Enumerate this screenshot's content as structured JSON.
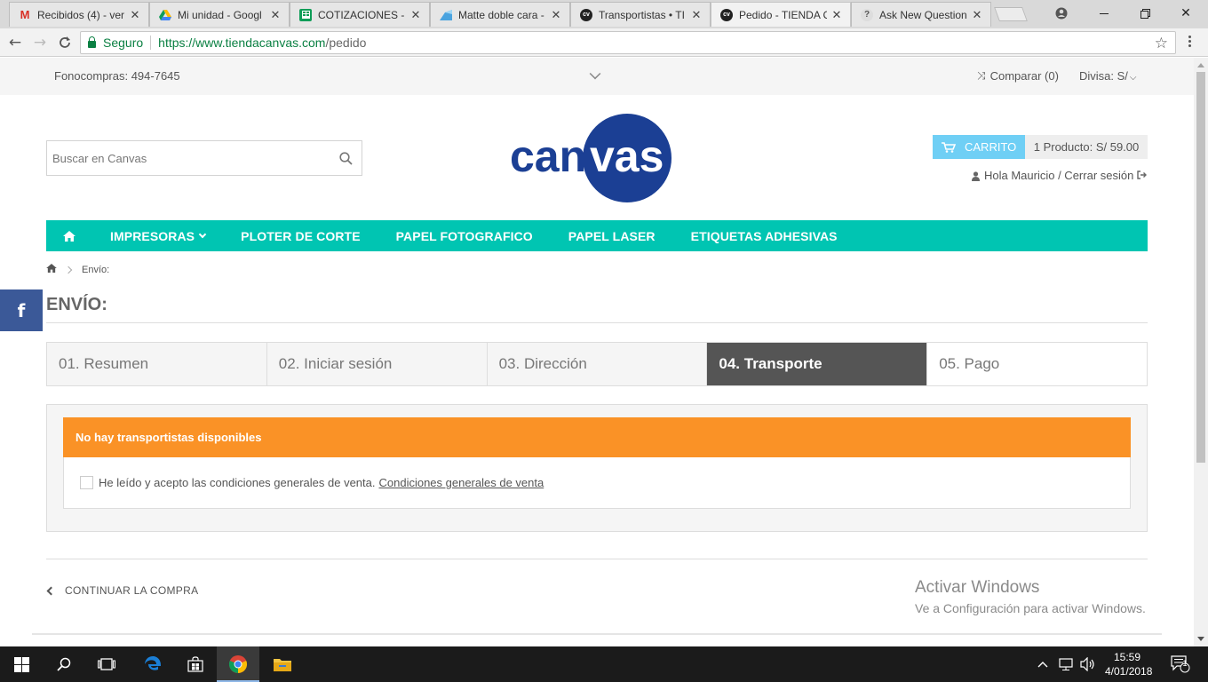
{
  "browser": {
    "tabs": [
      {
        "title": "Recibidos (4) - ver",
        "favicon": "gmail-icon"
      },
      {
        "title": "Mi unidad - Googl",
        "favicon": "drive-icon"
      },
      {
        "title": "COTIZACIONES - K",
        "favicon": "sheets-icon"
      },
      {
        "title": "Matte doble cara -",
        "favicon": "shop-icon"
      },
      {
        "title": "Transportistas • TI",
        "favicon": "canvas-icon"
      },
      {
        "title": "Pedido - TIENDA C",
        "favicon": "canvas-icon",
        "active": true
      },
      {
        "title": "Ask New Question",
        "favicon": "question-icon"
      }
    ],
    "secure_label": "Seguro",
    "url_host": "https://www.tiendacanvas.com",
    "url_path": "/pedido"
  },
  "site": {
    "phone": "Fonocompras: 494-7645",
    "compare": "Comparar (0)",
    "currency": "Divisa: S/",
    "search_placeholder": "Buscar en Canvas",
    "logo_text_left": "can",
    "logo_text_right": "vas",
    "cart_label": "CARRITO",
    "cart_info": "1 Producto: S/ 59.00",
    "greeting": "Hola Mauricio / Cerrar sesión",
    "nav": [
      "IMPRESORAS",
      "PLOTER DE CORTE",
      "PAPEL FOTOGRAFICO",
      "PAPEL LASER",
      "ETIQUETAS ADHESIVAS"
    ],
    "breadcrumb_current": "Envío:",
    "page_title": "ENVÍO:",
    "steps": [
      {
        "label": "01. Resumen"
      },
      {
        "label": "02. Iniciar sesión"
      },
      {
        "label": "03. Dirección"
      },
      {
        "label": "04. Transporte",
        "active": true
      },
      {
        "label": "05. Pago"
      }
    ],
    "alert": "No hay transportistas disponibles",
    "terms_text": "He leído y acepto las condiciones generales de venta.",
    "terms_link": "Condiciones generales de venta",
    "continue": "CONTINUAR LA COMPRA",
    "facebook": "f"
  },
  "watermark": {
    "line1": "Activar Windows",
    "line2": "Ve a Configuración para activar Windows."
  },
  "taskbar": {
    "time": "15:59",
    "date": "4/01/2018",
    "notifications": "1"
  },
  "colors": {
    "nav_teal": "#00c5b2",
    "alert_orange": "#fa9226",
    "cart_blue": "#6fcff5",
    "logo_navy": "#1b3f94",
    "facebook": "#3b5998"
  }
}
